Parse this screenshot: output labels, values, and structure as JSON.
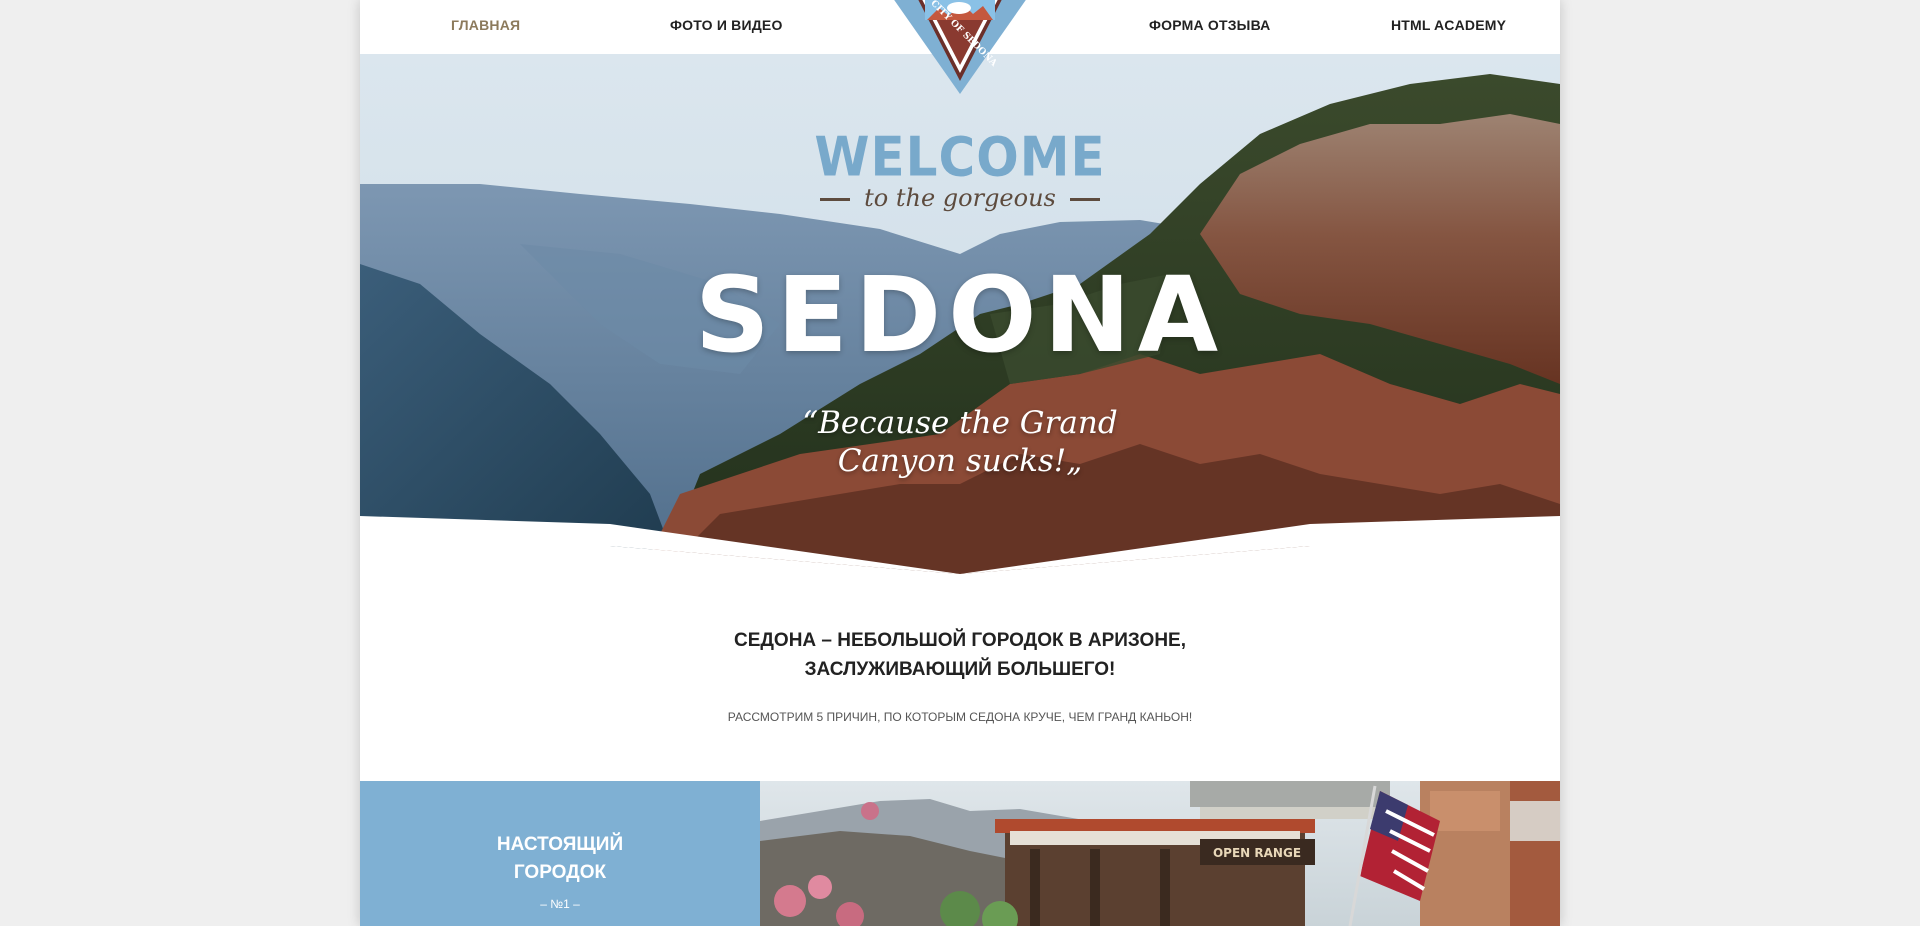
{
  "nav": {
    "items": [
      "ГЛАВНАЯ",
      "ФОТО И ВИДЕО",
      "ФОРМА ОТЗЫВА",
      "HTML ACADEMY"
    ],
    "active": "ГЛАВНАЯ"
  },
  "logo": {
    "text": "CITY OF SEDONA"
  },
  "hero": {
    "welcome": "WELCOME",
    "subtitle": "to the gorgeous",
    "title": "SEDONA",
    "tagline_line1": "“Because the Grand",
    "tagline_line2": "Canyon sucks!„"
  },
  "intro": {
    "title_line1": "СЕДОНА – НЕБОЛЬШОЙ ГОРОДОК В АРИЗОНЕ,",
    "title_line2": "ЗАСЛУЖИВАЮЩИЙ БОЛЬШЕГО!",
    "text": "РАССМОТРИМ 5 ПРИЧИН, ПО КОТОРЫМ СЕДОНА КРУЧЕ, ЧЕМ ГРАНД КАНЬОН!"
  },
  "feature": {
    "title_line1": "НАСТОЯЩИЙ",
    "title_line2": "ГОРОДОК",
    "number": "– №1 –",
    "sign_text": "OPEN RANGE"
  },
  "colors": {
    "accent": "#7fb0d3",
    "active_nav": "#8c7a5c",
    "page_bg": "#efefef"
  }
}
